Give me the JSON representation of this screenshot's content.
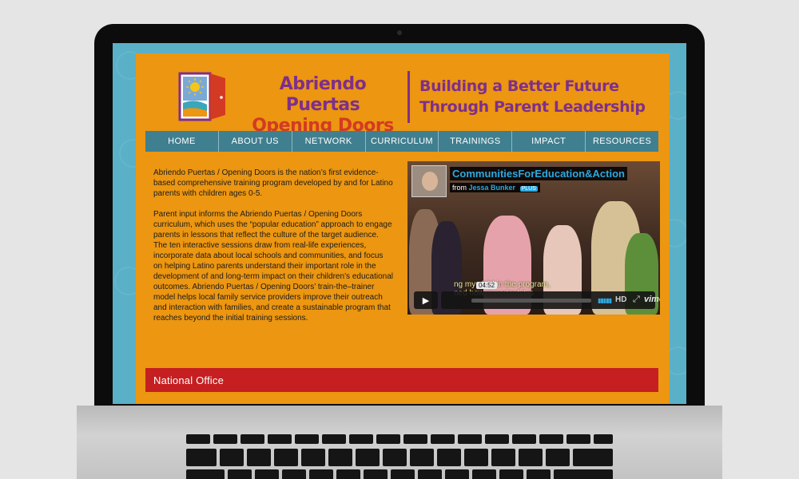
{
  "brand": {
    "name_line1": "Abriendo Puertas",
    "name_line2": "Opening Doors",
    "tagline_line1": "Building a Better Future",
    "tagline_line2": "Through Parent Leadership",
    "logo_icon": "open-door-sun-icon"
  },
  "nav": {
    "items": [
      "HOME",
      "ABOUT US",
      "NETWORK",
      "CURRICULUM",
      "TRAININGS",
      "IMPACT",
      "RESOURCES"
    ]
  },
  "content": {
    "paragraph1": "Abriendo Puertas / Opening Doors is the nation’s first evidence-based comprehensive training program developed by and for Latino parents with children ages 0-5.",
    "paragraph2": "Parent input informs the Abriendo Puertas / Opening Doors curriculum, which uses the “popular education” approach to engage parents in lessons that reflect the culture of the target audience. The ten interactive sessions draw from real-life experiences, incorporate data about local schools and communities, and focus on helping Latino parents understand their important role in the development of and long-term impact on their children’s educational outcomes. Abriendo Puertas / Opening Doors’ train-the–trainer model helps local family service providers improve their outreach and interaction with families, and create a sustainable program that reaches beyond the initial training sessions."
  },
  "video": {
    "title": "CommunitiesForEducation&Action",
    "from_label": "from",
    "author": "Jessa Bunker",
    "badge": "PLUS",
    "caption_line1": "ng my child in the program,",
    "caption_line2": "ned how important it is",
    "time": "04:52",
    "hd_label": "HD",
    "brand": "vimeo",
    "play_icon": "play-icon",
    "fullscreen_icon": "fullscreen-icon",
    "volume_icon": "volume-icon"
  },
  "office": {
    "heading": "National Office"
  },
  "colors": {
    "page_bg": "#ec9611",
    "screen_bg": "#5ab0c6",
    "purple": "#7e2f8a",
    "red": "#c51f21",
    "nav_bg": "#3f7f8f",
    "vimeo_blue": "#2ea8e0"
  }
}
